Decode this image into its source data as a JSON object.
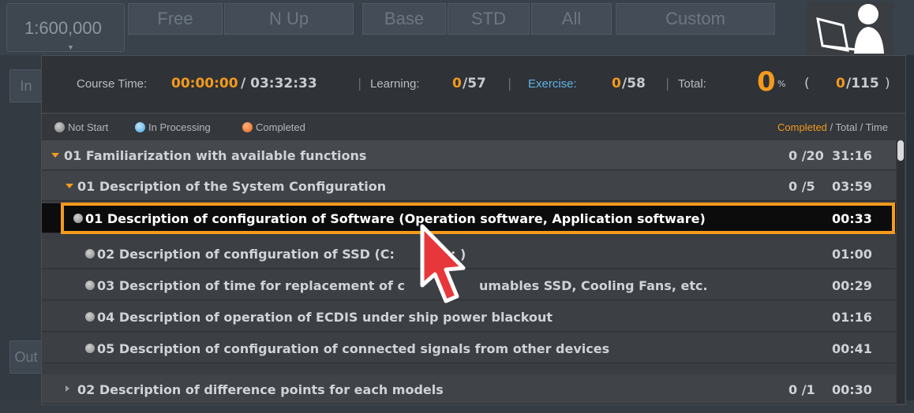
{
  "toolbar": {
    "scale": "1:600,000",
    "buttons": [
      "Free",
      "N Up",
      "Base",
      "STD",
      "All",
      "Custom"
    ]
  },
  "side": {
    "in_label": "In",
    "out_label": "Out"
  },
  "summary": {
    "course_time_label": "Course Time:",
    "course_time_elapsed": "00:00:00",
    "course_time_total": "/ 03:32:33",
    "learning_label": "Learning:",
    "learning_done": "0",
    "learning_total": "/57",
    "exercise_label": "Exercise:",
    "exercise_done": "0",
    "exercise_total": "/58",
    "total_label": "Total:",
    "total_percent": "0",
    "percent_sign": "%",
    "open_paren": "(",
    "total_done": "0",
    "total_all": "/115",
    "close_paren": ")"
  },
  "legend": {
    "not_start": "Not Start",
    "in_processing": "In Processing",
    "completed": "Completed",
    "right_completed": "Completed",
    "right_rest": " / Total / Time",
    "colors": {
      "not_start": "#9a9a9a",
      "in_processing": "#6ab8ea",
      "completed": "#f0752a"
    }
  },
  "rows": [
    {
      "text": "01 Familiarization with available functions",
      "count": "0 /20",
      "time": "31:16"
    },
    {
      "text": "01 Description of the System Configuration",
      "count": "0 /5",
      "time": "03:59"
    },
    {
      "text": "01 Description of configuration of Software (Operation software, Application software)",
      "time": "00:33"
    },
    {
      "text": "02 Description of configuration of SSD (C:",
      "tail": ": )",
      "time": "01:00"
    },
    {
      "text": "03 Description of time for replacement of c",
      "tail": "umables SSD, Cooling Fans, etc.",
      "time": "00:29"
    },
    {
      "text": "04 Description of operation of ECDIS under ship power blackout",
      "time": "01:16"
    },
    {
      "text": "05 Description of configuration of connected signals from other devices",
      "time": "00:41"
    },
    {
      "text": "02 Description of difference points for each models",
      "count": "0 /1",
      "time": "00:30"
    }
  ],
  "accent": "#f39a1d"
}
